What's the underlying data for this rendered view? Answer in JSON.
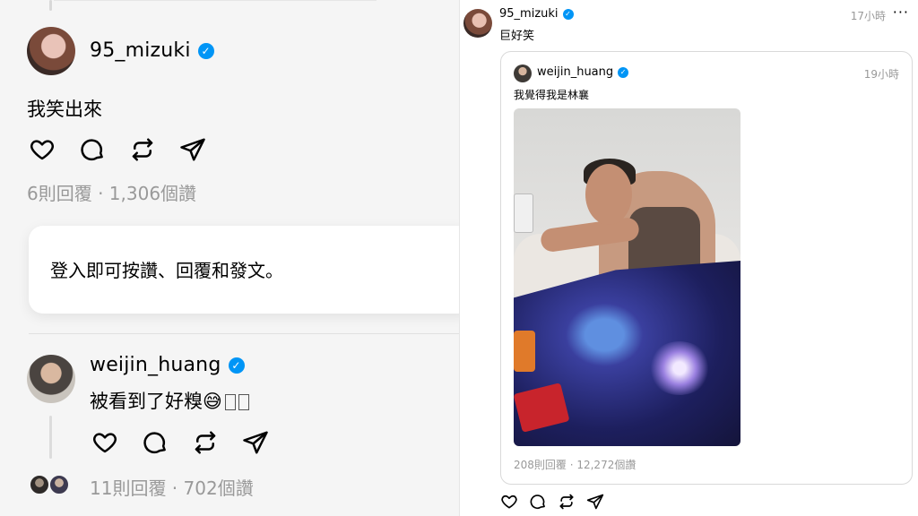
{
  "left": {
    "post": {
      "username": "95_mizuki",
      "verified": true,
      "text": "我笑出來",
      "meta": "6則回覆 · 1,306個讚"
    },
    "login_prompt": "登入即可按讚、回覆和發文。",
    "reply": {
      "username": "weijin_huang",
      "verified": true,
      "text": "被看到了好糗😅",
      "meta": "11則回覆 · 702個讚"
    }
  },
  "right": {
    "post": {
      "username": "95_mizuki",
      "verified": true,
      "time": "17小時",
      "more": "···",
      "text": "巨好笑"
    },
    "quoted": {
      "username": "weijin_huang",
      "verified": true,
      "time": "19小時",
      "text": "我覺得我是林襄",
      "meta": "208則回覆 · 12,272個讚"
    }
  },
  "icons": [
    "heart-icon",
    "comment-icon",
    "repost-icon",
    "share-icon",
    "verified-badge-icon"
  ],
  "colors": {
    "verified": "#0095f6",
    "meta_gray": "#999999"
  }
}
